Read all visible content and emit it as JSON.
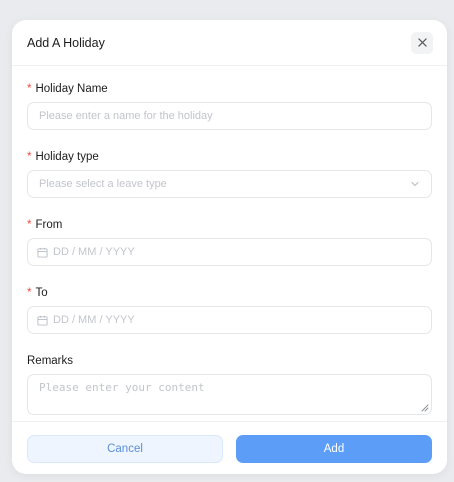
{
  "modal": {
    "title": "Add A Holiday",
    "close_icon": "close-icon"
  },
  "form": {
    "holiday_name": {
      "required_mark": "*",
      "label": "Holiday Name",
      "placeholder": "Please enter a name for the holiday"
    },
    "holiday_type": {
      "required_mark": "*",
      "label": "Holiday type",
      "placeholder": "Please select a leave type",
      "icon": "chevron-down-icon"
    },
    "from": {
      "required_mark": "*",
      "label": "From",
      "placeholder": "DD / MM / YYYY",
      "icon": "calendar-icon"
    },
    "to": {
      "required_mark": "*",
      "label": "To",
      "placeholder": "DD / MM / YYYY",
      "icon": "calendar-icon"
    },
    "remarks": {
      "label": "Remarks",
      "placeholder": "Please enter your content"
    }
  },
  "footer": {
    "cancel_label": "Cancel",
    "add_label": "Add"
  },
  "colors": {
    "required": "#f5483d",
    "primary": "#5c9ef7",
    "cancel_bg": "#eef5fe",
    "cancel_text": "#5b8fd6"
  }
}
